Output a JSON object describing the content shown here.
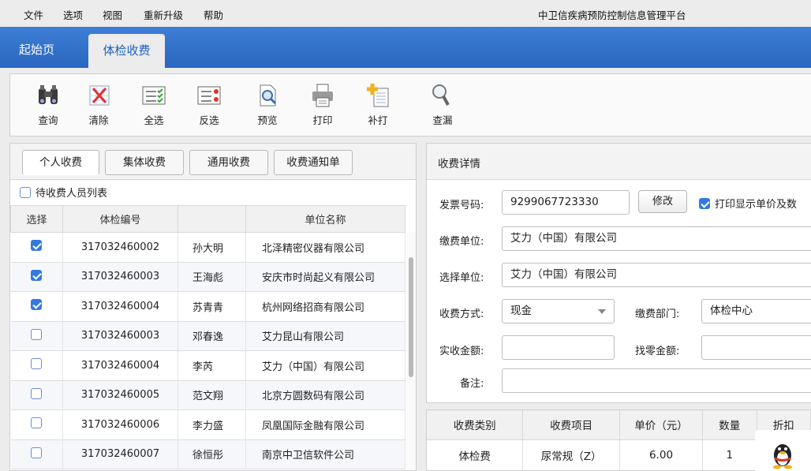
{
  "menu": [
    "文件",
    "选项",
    "视图",
    "重新升级",
    "帮助"
  ],
  "app_title": "中卫信疾病预防控制信息管理平台",
  "top_tabs": {
    "home": "起始页",
    "active": "体检收费"
  },
  "toolbar": [
    {
      "label": "查询",
      "icon": "binoculars-icon"
    },
    {
      "label": "清除",
      "icon": "clear-icon"
    },
    {
      "label": "全选",
      "icon": "select-all-icon"
    },
    {
      "label": "反选",
      "icon": "invert-selection-icon"
    },
    {
      "label": "预览",
      "icon": "preview-icon"
    },
    {
      "label": "打印",
      "icon": "printer-icon"
    },
    {
      "label": "补打",
      "icon": "reprint-icon"
    },
    {
      "label": "查漏",
      "icon": "magnifier-icon"
    }
  ],
  "left": {
    "tabs": [
      "个人收费",
      "集体收费",
      "通用收费",
      "收费通知单"
    ],
    "pending_label": "待收费人员列表",
    "pending_checked": false,
    "columns": [
      "选择",
      "体检编号",
      "",
      "单位名称"
    ],
    "rows": [
      {
        "checked": true,
        "id": "317032460002",
        "name": "孙大明",
        "unit": "北泽精密仪器有限公司"
      },
      {
        "checked": true,
        "id": "317032460003",
        "name": "王海彪",
        "unit": "安庆市时尚起义有限公司"
      },
      {
        "checked": true,
        "id": "317032460004",
        "name": "苏青青",
        "unit": "杭州网络招商有限公司"
      },
      {
        "checked": false,
        "id": "317032460003",
        "name": "邓春逸",
        "unit": "艾力昆山有限公司"
      },
      {
        "checked": false,
        "id": "317032460004",
        "name": "李芮",
        "unit": "艾力（中国）有限公司"
      },
      {
        "checked": false,
        "id": "317032460005",
        "name": "范文翔",
        "unit": "北京方圆数码有限公司"
      },
      {
        "checked": false,
        "id": "317032460006",
        "name": "李力盛",
        "unit": "凤凰国际金融有限公司"
      },
      {
        "checked": false,
        "id": "317032460007",
        "name": "徐恒彤",
        "unit": "南京中卫信软件公司"
      }
    ]
  },
  "detail": {
    "title": "收费详情",
    "invoice_label": "发票号码:",
    "invoice_value": "9299067723330",
    "modify_button": "修改",
    "print_unit_label": "打印显示单价及数",
    "print_unit_checked": true,
    "payer_label": "缴费单位:",
    "payer_value": "艾力（中国）有限公司",
    "select_unit_label": "选择单位:",
    "select_unit_value": "艾力（中国）有限公司",
    "pay_method_label": "收费方式:",
    "pay_method_value": "现金",
    "dept_label": "缴费部门:",
    "dept_value": "体检中心",
    "received_label": "实收金额:",
    "received_value": "",
    "change_label": "找零金额:",
    "change_value": "",
    "remark_label": "备注:",
    "remark_value": ""
  },
  "fee_table": {
    "columns": [
      "收费类别",
      "收费项目",
      "单价（元）",
      "数量",
      "折扣"
    ],
    "rows": [
      {
        "category": "体检费",
        "item": "尿常规（Z）",
        "price": "6.00",
        "qty": "1"
      }
    ]
  }
}
